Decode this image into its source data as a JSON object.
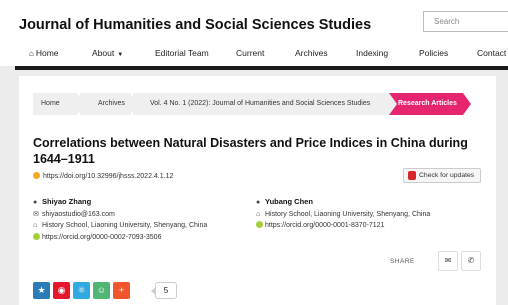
{
  "header": {
    "site_title": "Journal of Humanities and Social Sciences Studies",
    "search_placeholder": "Search"
  },
  "nav": {
    "items": [
      {
        "label": "Home",
        "icon": "home-icon"
      },
      {
        "label": "About",
        "icon": "caret-down-icon"
      },
      {
        "label": "Editorial Team"
      },
      {
        "label": "Current"
      },
      {
        "label": "Archives"
      },
      {
        "label": "Indexing"
      },
      {
        "label": "Policies"
      },
      {
        "label": "Contact"
      }
    ]
  },
  "breadcrumb": {
    "items": [
      "Home",
      "Archives",
      "Vol. 4 No. 1 (2022): Journal of Humanities and Social Sciences Studies",
      "Research Articles"
    ],
    "active_color": "#e5256f"
  },
  "article": {
    "title": "Correlations between Natural Disasters and Price Indices in China during 1644–1911",
    "doi": "https://doi.org/10.32996/jhsss.2022.4.1.12",
    "check_updates_label": "Check for updates"
  },
  "authors": [
    {
      "name": "Shiyao Zhang",
      "email": "shiyaostudio@163.com",
      "affiliation": "History School, Liaoning University, Shenyang, China",
      "orcid": "https://orcid.org/0000-0002-7093-3506"
    },
    {
      "name": "Yubang Chen",
      "affiliation": "History School, Liaoning University, Shenyang, China",
      "orcid": "https://orcid.org/0000-0001-8370-7121"
    }
  ],
  "share": {
    "label": "SHARE",
    "count": "5",
    "social_colors": [
      "#2b7bb9",
      "#e6162d",
      "#31a9e1",
      "#50b674",
      "#f0562b"
    ]
  }
}
